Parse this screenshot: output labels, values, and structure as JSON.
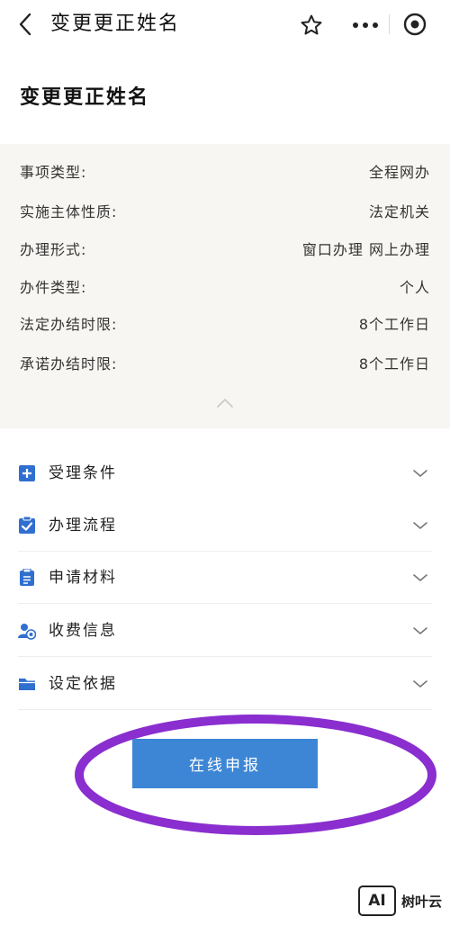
{
  "nav": {
    "title": "变更更正姓名"
  },
  "page": {
    "title": "变更更正姓名"
  },
  "info": [
    {
      "label": "事项类型:",
      "value": "全程网办"
    },
    {
      "label": "实施主体性质:",
      "value": "法定机关"
    },
    {
      "label": "办理形式:",
      "value": "窗口办理 网上办理"
    },
    {
      "label": "办件类型:",
      "value": "个人"
    },
    {
      "label": "法定办结时限:",
      "value": "8个工作日"
    },
    {
      "label": "承诺办结时限:",
      "value": "8个工作日"
    }
  ],
  "sections": [
    {
      "label": "受理条件",
      "icon": "plus-square-icon"
    },
    {
      "label": "办理流程",
      "icon": "checklist-icon"
    },
    {
      "label": "申请材料",
      "icon": "clipboard-icon"
    },
    {
      "label": "收费信息",
      "icon": "user-fee-icon"
    },
    {
      "label": "设定依据",
      "icon": "folder-icon"
    }
  ],
  "apply_button": {
    "label": "在线申报"
  },
  "watermark": {
    "logo": "AI",
    "text": "树叶云"
  },
  "colors": {
    "accent": "#3d86d6",
    "highlight": "#8a2ecf",
    "panel_bg": "#f7f6f2"
  }
}
